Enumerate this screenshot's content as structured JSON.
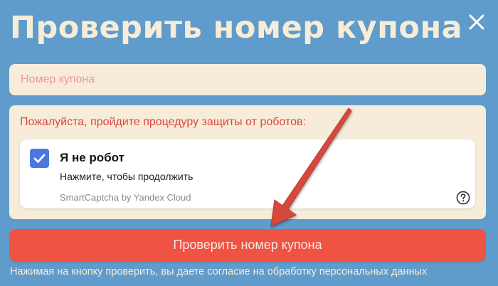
{
  "modal": {
    "title": "Проверить номер купона"
  },
  "coupon_input": {
    "placeholder": "Номер купона",
    "value": ""
  },
  "captcha": {
    "prompt": "Пожалуйста, пройдите процедуру защиты от роботов:",
    "checkbox_label": "Я не робот",
    "hint": "Нажмите, чтобы продолжить",
    "brand": "SmartCaptcha by Yandex Cloud",
    "checked": true
  },
  "submit": {
    "label": "Проверить номер купона"
  },
  "consent": {
    "text": "Нажимая на кнопку проверить, вы даете согласие на обработку персональных данных"
  },
  "icons": {
    "close": "close-icon",
    "checkbox": "checkmark-icon",
    "help": "question-circle-icon",
    "annotation": "arrow-icon"
  },
  "colors": {
    "background": "#5f9ccb",
    "title": "#f7ecd8",
    "panel": "#f6ecd9",
    "accent_red": "#ef5344",
    "checkbox_blue": "#4b77e4"
  }
}
